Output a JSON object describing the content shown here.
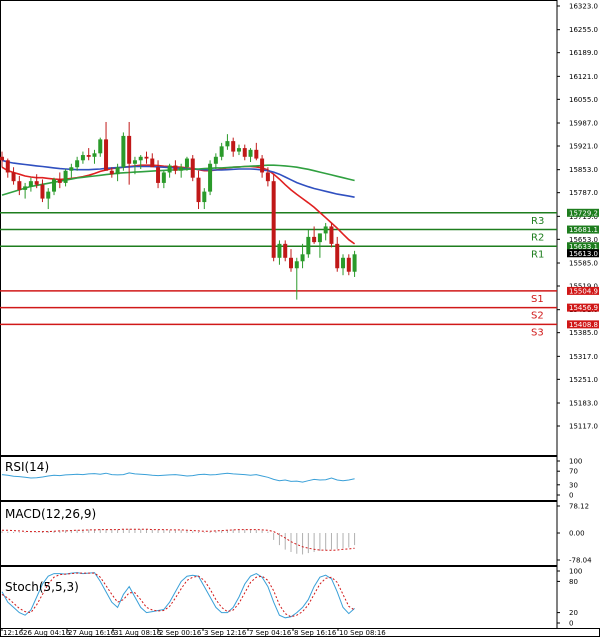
{
  "chart_data": [
    {
      "type": "candlestick",
      "panel": "price",
      "ylim": [
        15117.0,
        16323.0
      ],
      "y_ticks": [
        "16323.0",
        "16255.0",
        "16189.0",
        "16121.0",
        "16055.0",
        "15987.0",
        "15921.0",
        "15853.0",
        "15787.0",
        "15719.0",
        "15653.0",
        "15585.0",
        "15519.0",
        "15451.0",
        "15385.0",
        "15317.0",
        "15251.0",
        "15183.0",
        "15117.0"
      ],
      "x_ticks": [
        "12:16",
        "26 Aug 04:16",
        "27 Aug 16:16",
        "31 Aug 08:16",
        "2 Sep 00:16",
        "3 Sep 12:16",
        "7 Sep 04:16",
        "8 Sep 16:16",
        "10 Sep 08:16"
      ],
      "candles": [
        [
          15890,
          15905,
          15860,
          15880
        ],
        [
          15880,
          15885,
          15830,
          15845
        ],
        [
          15845,
          15860,
          15810,
          15820
        ],
        [
          15820,
          15835,
          15780,
          15795
        ],
        [
          15795,
          15815,
          15770,
          15805
        ],
        [
          15805,
          15830,
          15790,
          15820
        ],
        [
          15820,
          15840,
          15800,
          15810
        ],
        [
          15810,
          15825,
          15760,
          15770
        ],
        [
          15770,
          15800,
          15740,
          15790
        ],
        [
          15790,
          15830,
          15780,
          15825
        ],
        [
          15825,
          15845,
          15800,
          15815
        ],
        [
          15815,
          15855,
          15805,
          15850
        ],
        [
          15850,
          15870,
          15830,
          15860
        ],
        [
          15860,
          15890,
          15850,
          15880
        ],
        [
          15880,
          15905,
          15870,
          15895
        ],
        [
          15895,
          15915,
          15880,
          15890
        ],
        [
          15890,
          15910,
          15870,
          15900
        ],
        [
          15900,
          15945,
          15890,
          15940
        ],
        [
          15940,
          15990,
          15920,
          15850
        ],
        [
          15850,
          15860,
          15830,
          15840
        ],
        [
          15840,
          15870,
          15820,
          15860
        ],
        [
          15860,
          15960,
          15850,
          15950
        ],
        [
          15950,
          15990,
          15810,
          15870
        ],
        [
          15870,
          15890,
          15840,
          15880
        ],
        [
          15880,
          15895,
          15855,
          15890
        ],
        [
          15890,
          15905,
          15870,
          15885
        ],
        [
          15885,
          15900,
          15870,
          15860
        ],
        [
          15860,
          15880,
          15800,
          15815
        ],
        [
          15815,
          15850,
          15800,
          15845
        ],
        [
          15845,
          15870,
          15830,
          15865
        ],
        [
          15865,
          15880,
          15840,
          15850
        ],
        [
          15850,
          15870,
          15830,
          15860
        ],
        [
          15860,
          15890,
          15850,
          15885
        ],
        [
          15885,
          15895,
          15820,
          15830
        ],
        [
          15830,
          15850,
          15740,
          15760
        ],
        [
          15760,
          15800,
          15740,
          15790
        ],
        [
          15790,
          15880,
          15780,
          15870
        ],
        [
          15870,
          15900,
          15855,
          15890
        ],
        [
          15890,
          15930,
          15880,
          15920
        ],
        [
          15920,
          15955,
          15910,
          15935
        ],
        [
          15935,
          15945,
          15890,
          15905
        ],
        [
          15905,
          15925,
          15895,
          15915
        ],
        [
          15915,
          15925,
          15880,
          15890
        ],
        [
          15890,
          15915,
          15875,
          15910
        ],
        [
          15910,
          15930,
          15880,
          15885
        ],
        [
          15885,
          15895,
          15830,
          15845
        ],
        [
          15845,
          15860,
          15805,
          15820
        ],
        [
          15820,
          15840,
          15590,
          15600
        ],
        [
          15600,
          15650,
          15580,
          15640
        ],
        [
          15640,
          15650,
          15590,
          15600
        ],
        [
          15600,
          15625,
          15560,
          15570
        ],
        [
          15570,
          15600,
          15480,
          15590
        ],
        [
          15590,
          15640,
          15570,
          15610
        ],
        [
          15610,
          15680,
          15600,
          15660
        ],
        [
          15660,
          15690,
          15640,
          15645
        ],
        [
          15645,
          15670,
          15600,
          15670
        ],
        [
          15670,
          15700,
          15650,
          15690
        ],
        [
          15690,
          15700,
          15630,
          15640
        ],
        [
          15640,
          15660,
          15560,
          15570
        ],
        [
          15570,
          15610,
          15550,
          15600
        ],
        [
          15600,
          15610,
          15550,
          15560
        ],
        [
          15560,
          15620,
          15545,
          15610
        ]
      ],
      "moving_averages": [
        {
          "color": "#e02020",
          "values": [
            15860,
            15850,
            15845,
            15840,
            15835,
            15832,
            15830,
            15830,
            15828,
            15826,
            15825,
            15826,
            15828,
            15830,
            15833,
            15837,
            15842,
            15848,
            15852,
            15856,
            15858,
            15860,
            15862,
            15864,
            15866,
            15866,
            15866,
            15865,
            15863,
            15862,
            15861,
            15860,
            15858,
            15856,
            15853,
            15850,
            15850,
            15852,
            15855,
            15858,
            15860,
            15861,
            15862,
            15862,
            15861,
            15858,
            15852,
            15840,
            15826,
            15810,
            15795,
            15782,
            15770,
            15758,
            15745,
            15730,
            15715,
            15700,
            15685,
            15668,
            15652,
            15640
          ]
        },
        {
          "color": "#3050c0",
          "values": [
            15880,
            15875,
            15872,
            15870,
            15868,
            15866,
            15864,
            15862,
            15860,
            15858,
            15856,
            15855,
            15854,
            15853,
            15853,
            15853,
            15854,
            15855,
            15857,
            15858,
            15859,
            15860,
            15861,
            15862,
            15862,
            15862,
            15862,
            15861,
            15860,
            15859,
            15858,
            15857,
            15856,
            15855,
            15854,
            15853,
            15852,
            15852,
            15852,
            15853,
            15854,
            15855,
            15855,
            15855,
            15854,
            15852,
            15850,
            15846,
            15840,
            15832,
            15824,
            15816,
            15810,
            15804,
            15799,
            15795,
            15791,
            15787,
            15783,
            15780,
            15777,
            15774
          ]
        },
        {
          "color": "#30a040",
          "values": [
            15780,
            15785,
            15790,
            15795,
            15800,
            15805,
            15808,
            15811,
            15814,
            15817,
            15820,
            15823,
            15826,
            15829,
            15831,
            15833,
            15835,
            15837,
            15839,
            15841,
            15843,
            15844,
            15845,
            15846,
            15847,
            15848,
            15849,
            15850,
            15851,
            15852,
            15852,
            15853,
            15854,
            15855,
            15855,
            15856,
            15857,
            15858,
            15858,
            15859,
            15860,
            15861,
            15862,
            15863,
            15864,
            15865,
            15866,
            15866,
            15865,
            15864,
            15862,
            15860,
            15857,
            15854,
            15850,
            15846,
            15842,
            15838,
            15834,
            15830,
            15826,
            15822
          ]
        }
      ],
      "levels": [
        {
          "name": "R3",
          "value": 15729.2,
          "color": "#1e7d1e"
        },
        {
          "name": "R2",
          "value": 15681.1,
          "color": "#1e7d1e"
        },
        {
          "name": "R1",
          "value": 15633.1,
          "color": "#1e7d1e"
        },
        {
          "name": "S1",
          "value": 15504.9,
          "color": "#d01818"
        },
        {
          "name": "S2",
          "value": 15456.9,
          "color": "#d01818"
        },
        {
          "name": "S3",
          "value": 15408.8,
          "color": "#d01818"
        }
      ],
      "current_price": {
        "label": "15613.0",
        "value": 15613.0
      }
    },
    {
      "type": "line",
      "panel": "rsi",
      "title": "RSI(14)",
      "ylim": [
        0,
        100
      ],
      "y_ticks": [
        "100",
        "70",
        "30",
        "0"
      ],
      "series": [
        {
          "color": "#3aa0d8",
          "values": [
            60,
            58,
            55,
            54,
            52,
            50,
            51,
            53,
            56,
            58,
            57,
            59,
            60,
            61,
            60,
            62,
            63,
            61,
            64,
            60,
            59,
            60,
            65,
            62,
            61,
            60,
            58,
            57,
            58,
            59,
            60,
            58,
            56,
            57,
            60,
            61,
            59,
            60,
            62,
            64,
            62,
            61,
            60,
            58,
            60,
            56,
            52,
            46,
            42,
            44,
            40,
            41,
            38,
            42,
            46,
            44,
            45,
            50,
            44,
            42,
            44,
            48
          ]
        }
      ]
    },
    {
      "type": "line",
      "panel": "macd",
      "title": "MACD(12,26,9)",
      "ylim": [
        -78.04,
        78.12
      ],
      "y_ticks": [
        "78.12",
        "0.00",
        "-78.04"
      ],
      "series": [
        {
          "color": "#d01818",
          "values": [
            8,
            8,
            7,
            6,
            5,
            4,
            4,
            4,
            4,
            5,
            6,
            6,
            7,
            8,
            8,
            9,
            9,
            10,
            10,
            10,
            10,
            11,
            11,
            11,
            11,
            11,
            10,
            10,
            10,
            9,
            9,
            9,
            8,
            7,
            6,
            5,
            5,
            6,
            7,
            8,
            9,
            10,
            10,
            10,
            10,
            9,
            8,
            4,
            -5,
            -14,
            -25,
            -33,
            -40,
            -44,
            -47,
            -49,
            -50,
            -50,
            -49,
            -47,
            -46,
            -44
          ]
        }
      ],
      "histogram": [
        5,
        4,
        3,
        2,
        2,
        1,
        2,
        3,
        5,
        6,
        7,
        8,
        8,
        9,
        10,
        10,
        11,
        11,
        11,
        10,
        10,
        11,
        12,
        11,
        11,
        10,
        9,
        9,
        9,
        8,
        8,
        8,
        7,
        5,
        3,
        2,
        3,
        5,
        7,
        9,
        10,
        10,
        10,
        10,
        9,
        7,
        4,
        -20,
        -35,
        -48,
        -55,
        -60,
        -62,
        -58,
        -55,
        -52,
        -50,
        -48,
        -46,
        -44,
        -42,
        -35
      ]
    },
    {
      "type": "line",
      "panel": "stochastic",
      "title": "Stoch(5,5,3)",
      "ylim": [
        0,
        100
      ],
      "y_ticks": [
        "100",
        "80",
        "20",
        "0"
      ],
      "series": [
        {
          "color": "#3aa0d8",
          "values": [
            60,
            40,
            30,
            20,
            15,
            25,
            50,
            75,
            90,
            95,
            95,
            94,
            96,
            97,
            95,
            96,
            97,
            80,
            60,
            40,
            30,
            55,
            70,
            50,
            30,
            20,
            22,
            24,
            26,
            40,
            60,
            80,
            90,
            92,
            90,
            70,
            50,
            30,
            20,
            20,
            30,
            50,
            75,
            90,
            95,
            88,
            70,
            40,
            15,
            10,
            12,
            20,
            30,
            45,
            70,
            88,
            92,
            85,
            60,
            30,
            18,
            28
          ]
        },
        {
          "color": "#d01818",
          "values": [
            55,
            48,
            38,
            28,
            22,
            20,
            35,
            55,
            75,
            88,
            93,
            94,
            95,
            96,
            96,
            96,
            96,
            88,
            72,
            55,
            40,
            45,
            58,
            58,
            45,
            30,
            25,
            23,
            24,
            32,
            48,
            66,
            82,
            88,
            90,
            82,
            65,
            45,
            30,
            22,
            25,
            38,
            58,
            78,
            88,
            90,
            82,
            62,
            35,
            18,
            12,
            15,
            22,
            35,
            55,
            75,
            86,
            88,
            78,
            55,
            32,
            25
          ]
        }
      ]
    }
  ]
}
